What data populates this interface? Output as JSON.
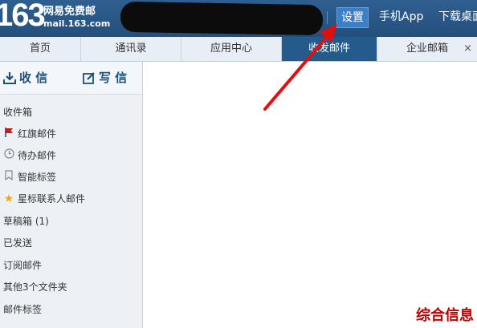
{
  "header": {
    "logo": "163",
    "brand_title": "网易免费邮",
    "brand_domain": "mail.163.com",
    "links": [
      {
        "label": "设置",
        "active": true
      },
      {
        "label": "手机App",
        "active": false
      },
      {
        "label": "下载桌面",
        "active": false
      }
    ]
  },
  "tabs": [
    {
      "label": "首页"
    },
    {
      "label": "通讯录"
    },
    {
      "label": "应用中心"
    },
    {
      "label": "收发邮件",
      "active": true
    },
    {
      "label": "企业邮箱",
      "closable": true,
      "close_label": "×"
    }
  ],
  "sidebar": {
    "receive_label": "收 信",
    "write_label": "写 信",
    "items": [
      {
        "label": "收件箱"
      },
      {
        "label": "红旗邮件",
        "icon": "flag-icon"
      },
      {
        "label": "待办邮件",
        "icon": "clock-icon"
      },
      {
        "label": "智能标签",
        "icon": "bookmark-icon"
      },
      {
        "label": "星标联系人邮件",
        "icon": "star-icon"
      },
      {
        "label": "草稿箱 (1)"
      },
      {
        "label": "已发送"
      },
      {
        "label": "订阅邮件"
      },
      {
        "label": "其他3个文件夹"
      },
      {
        "label": "邮件标签"
      }
    ]
  },
  "watermark": "综合信息",
  "colors": {
    "header_bg": "#2f5f90",
    "active_tab": "#245a8c",
    "arrow": "#e01010",
    "watermark": "#c00000"
  }
}
